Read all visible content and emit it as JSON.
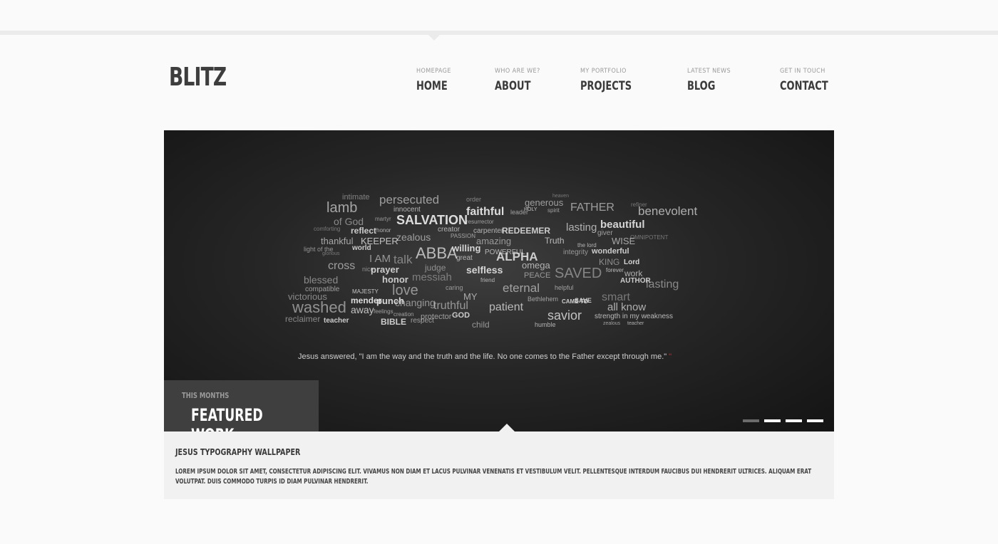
{
  "header": {
    "logo": "BLITZ",
    "nav": [
      {
        "sub": "HOMEPAGE",
        "label": "HOME"
      },
      {
        "sub": "WHO ARE WE?",
        "label": "ABOUT"
      },
      {
        "sub": "MY PORTFOLIO",
        "label": "PROJECTS"
      },
      {
        "sub": "LATEST NEWS",
        "label": "BLOG"
      },
      {
        "sub": "GET IN TOUCH",
        "label": "CONTACT"
      }
    ]
  },
  "slider": {
    "quote": "Jesus answered, \"I am the way and the truth and the life. No one comes to the Father except through me.\"",
    "quote_mark": "\"",
    "featured_kicker": "THIS MONTHS",
    "featured_title": "FEATURED WORK",
    "pager_count": 4,
    "pager_active": 0,
    "word_cloud": [
      "intimate",
      "persecuted",
      "order",
      "generous",
      "heaven",
      "lamb",
      "innocent",
      "faithful",
      "leader",
      "FATHER",
      "refiner",
      "benevolent",
      "of God",
      "martyr",
      "SALVATION",
      "resurrector",
      "HOLY",
      "spirit",
      "lasting",
      "beautiful",
      "comforting",
      "reflect",
      "honor",
      "creator",
      "carpenter",
      "REDEEMER",
      "giver",
      "OMNIPOTENT",
      "thankful",
      "KEEPER",
      "zealous",
      "PASSION",
      "amazing",
      "Truth",
      "the lord",
      "WISE",
      "light of the",
      "world",
      "willing",
      "POWERFUL",
      "integrity",
      "wonderful",
      "glorious",
      "I AM",
      "talk",
      "ABBA",
      "great",
      "ALPHA",
      "omega",
      "KING",
      "Lord",
      "cross",
      "nice",
      "prayer",
      "judge",
      "selfless",
      "PEACE",
      "SAVED",
      "forever",
      "work",
      "blessed",
      "honor",
      "messiah",
      "friend",
      "AUTHOR",
      "lasting",
      "compatible",
      "MAJESTY",
      "love",
      "caring",
      "eternal",
      "helpful",
      "smart",
      "victorious",
      "mender",
      "MY",
      "Bethlehem",
      "CAME TO",
      "SAVE",
      "washed",
      "away",
      "punch",
      "changing",
      "truthful",
      "patient",
      "all know",
      "reclaimer",
      "feelings",
      "creation",
      "protector",
      "GOD",
      "savior",
      "strength in my weakness",
      "teacher",
      "BIBLE",
      "respect",
      "child",
      "zealous",
      "humble",
      "teacher"
    ]
  },
  "panel": {
    "title": "JESUS TYPOGRAPHY WALLPAPER",
    "text": "LOREM IPSUM DOLOR SIT AMET, CONSECTETUR ADIPISCING ELIT. VIVAMUS NON DIAM ET LACUS PULVINAR VENENATIS ET VESTIBULUM VELIT. PELLENTESQUE INTERDUM FAUCIBUS DUI HENDRERIT ULTRICES. ALIQUAM ERAT VOLUTPAT. DUIS COMMODO TURPIS ID DIAM PULVINAR HENDRERIT."
  },
  "colors": {
    "background": "#fafafa",
    "text": "#3a3a3a",
    "slider_bg": "#1c1c1c",
    "featured_box": "#3f3f3f",
    "panel": "#f1f1f1",
    "accent_quote": "#aa3333"
  }
}
